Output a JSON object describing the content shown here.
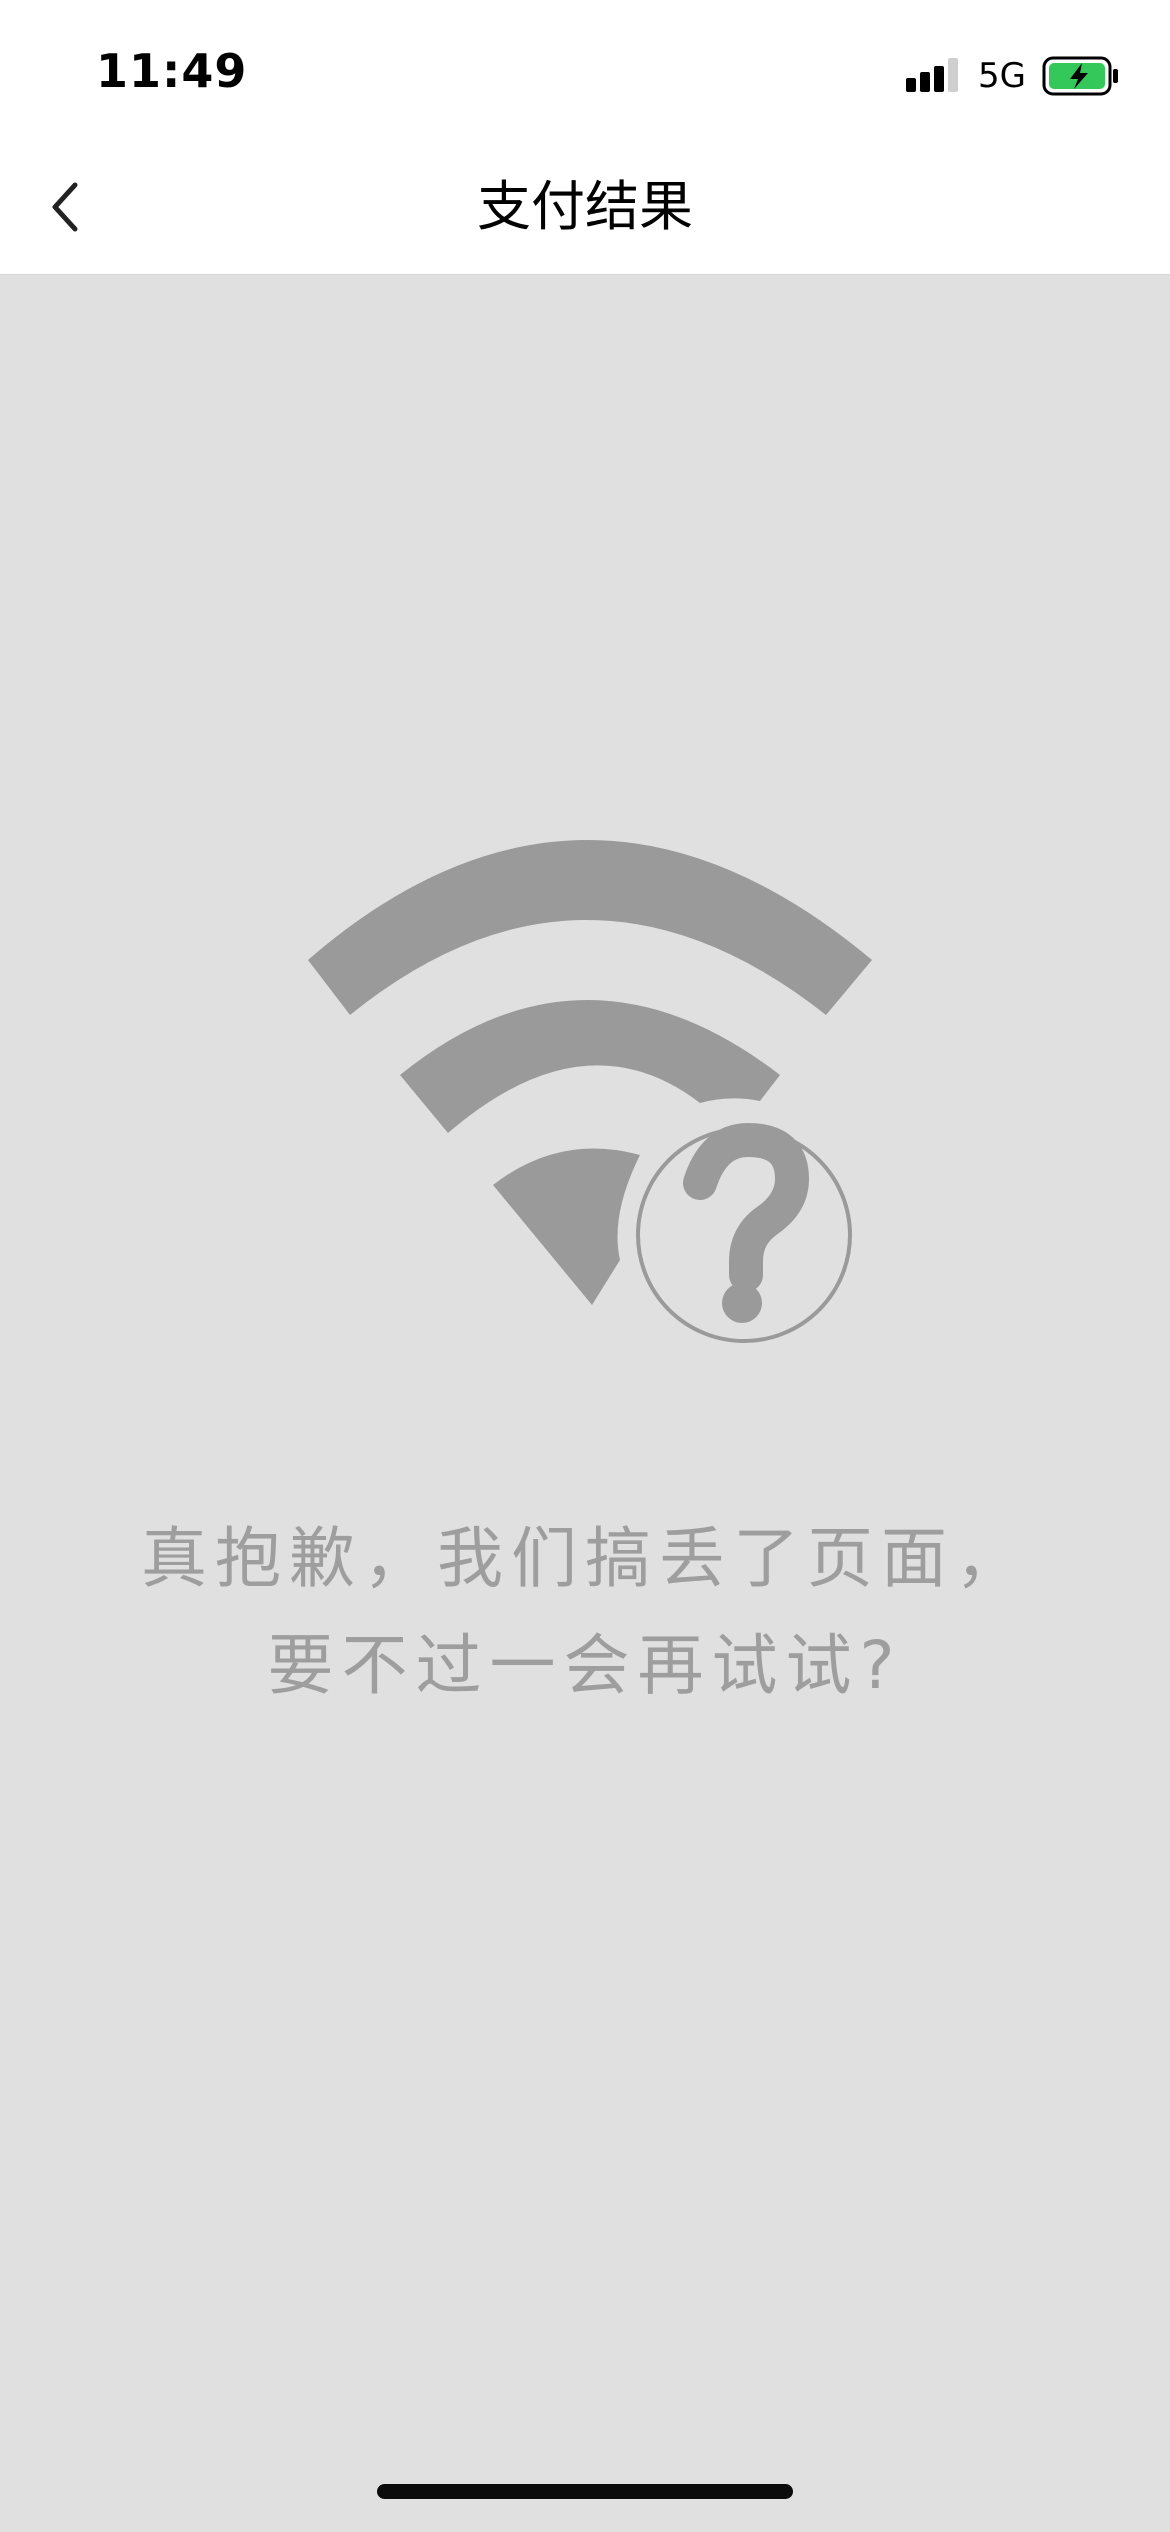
{
  "status_bar": {
    "time": "11:49",
    "network": "5G",
    "icons": [
      "signal-strength-icon",
      "battery-charging-icon"
    ],
    "battery_color": "#34c759"
  },
  "nav": {
    "title": "支付结果",
    "back_icon": "chevron-left-icon"
  },
  "error": {
    "icon": "wifi-question-icon",
    "line1": "真抱歉，我们搞丢了页面，",
    "line2": "要不过一会再试试?"
  },
  "colors": {
    "background": "#e0e0e0",
    "illustration": "#9a9a9a",
    "message_text": "#9e9e9e"
  }
}
